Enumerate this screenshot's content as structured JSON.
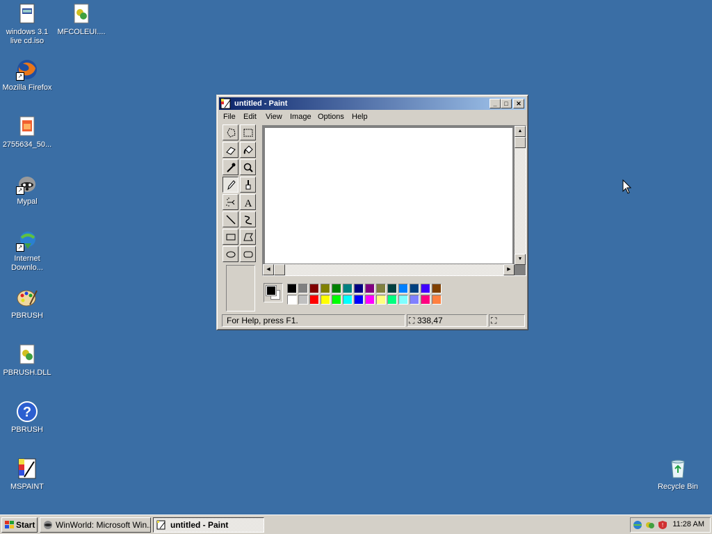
{
  "desktop": {
    "background_color": "#3a6ea5",
    "icons": [
      {
        "label": "windows 3.1 live cd.iso",
        "icon": "iso-file-icon"
      },
      {
        "label": "MFCOLEUI....",
        "icon": "dll-file-icon"
      },
      {
        "label": "Mozilla Firefox",
        "icon": "firefox-icon"
      },
      {
        "label": "2755634_50...",
        "icon": "image-file-icon"
      },
      {
        "label": "Mypal",
        "icon": "mypal-raccoon-icon"
      },
      {
        "label": "Internet Downlo...",
        "icon": "internet-download-manager-icon"
      },
      {
        "label": "PBRUSH",
        "icon": "paint-palette-icon"
      },
      {
        "label": "PBRUSH.DLL",
        "icon": "dll-file-icon"
      },
      {
        "label": "PBRUSH",
        "icon": "help-icon"
      },
      {
        "label": "MSPAINT",
        "icon": "mspaint-icon"
      },
      {
        "label": "Recycle Bin",
        "icon": "recycle-bin-icon"
      }
    ]
  },
  "window": {
    "title": "untitled - Paint",
    "menus": [
      "File",
      "Edit",
      "View",
      "Image",
      "Options",
      "Help"
    ],
    "tools": [
      "free-form-select",
      "rectangle-select",
      "eraser",
      "fill-bucket",
      "pick-color",
      "magnifier",
      "pencil",
      "brush",
      "airbrush",
      "text",
      "line",
      "curve",
      "rectangle",
      "polygon",
      "ellipse",
      "rounded-rectangle"
    ],
    "active_tool": "pencil",
    "palette": {
      "foreground": "#000000",
      "background": "#ffffff",
      "row1": [
        "#000000",
        "#808080",
        "#800000",
        "#808000",
        "#008000",
        "#008080",
        "#000080",
        "#800080",
        "#808040",
        "#004040",
        "#0080ff",
        "#004080",
        "#4000ff",
        "#804000"
      ],
      "row2": [
        "#ffffff",
        "#c0c0c0",
        "#ff0000",
        "#ffff00",
        "#00ff00",
        "#00ffff",
        "#0000ff",
        "#ff00ff",
        "#ffff80",
        "#00ff80",
        "#80ffff",
        "#8080ff",
        "#ff0080",
        "#ff8040"
      ]
    },
    "status": {
      "help": "For Help, press F1.",
      "coords": "338,47",
      "size": ""
    }
  },
  "taskbar": {
    "start_label": "Start",
    "items": [
      {
        "label": "WinWorld: Microsoft Win...",
        "active": false
      },
      {
        "label": "untitled - Paint",
        "active": true
      }
    ],
    "clock": "11:28 AM"
  }
}
